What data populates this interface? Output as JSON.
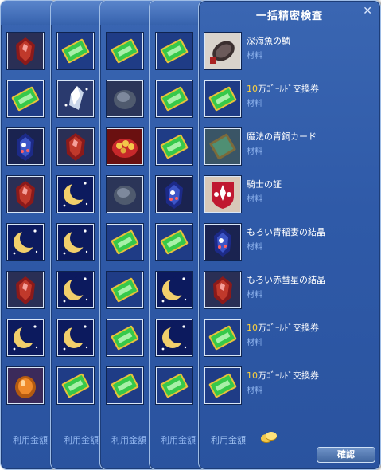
{
  "background_panels": [
    {
      "fee_label": "利用金額",
      "slots": [
        "red-gem-icon",
        "gold-ticket-icon",
        "blue-gem-icon",
        "red-gem-icon",
        "moon-icon",
        "red-gem-icon",
        "moon-icon",
        "orange-gem-icon"
      ]
    },
    {
      "fee_label": "利用金額",
      "slots": [
        "gold-ticket-icon",
        "crystal-icon",
        "red-gem-icon",
        "moon-icon",
        "moon-icon",
        "moon-icon",
        "moon-icon",
        "gold-ticket-icon"
      ]
    },
    {
      "fee_label": "利用金額",
      "slots": [
        "gold-ticket-icon",
        "stone-icon",
        "treasure-icon",
        "stone-icon",
        "gold-ticket-icon",
        "gold-ticket-icon",
        "gold-ticket-icon",
        "gold-ticket-icon"
      ]
    },
    {
      "fee_label": "利用金額",
      "slots": [
        "gold-ticket-icon",
        "gold-ticket-icon",
        "gold-ticket-icon",
        "blue-gem-icon",
        "gold-ticket-icon",
        "moon-icon",
        "moon-icon",
        "gold-ticket-icon"
      ]
    }
  ],
  "dialog": {
    "title": "一括精密検査",
    "close_icon": "close-icon",
    "items": [
      {
        "icon": "scale-icon",
        "name_highlight": "",
        "name": "深海魚の鱗",
        "category": "材料"
      },
      {
        "icon": "gold-ticket-icon",
        "name_highlight": "10",
        "name": "万ｺﾞｰﾙﾄﾞ交換券",
        "category": "材料"
      },
      {
        "icon": "card-icon",
        "name_highlight": "",
        "name": "魔法の青銅カード",
        "category": "材料"
      },
      {
        "icon": "emblem-icon",
        "name_highlight": "",
        "name": "騎士の証",
        "category": "材料"
      },
      {
        "icon": "blue-gem-icon",
        "name_highlight": "",
        "name": "もろい青稲妻の結晶",
        "category": "材料"
      },
      {
        "icon": "red-gem-icon",
        "name_highlight": "",
        "name": "もろい赤彗星の結晶",
        "category": "材料"
      },
      {
        "icon": "gold-ticket-icon",
        "name_highlight": "10",
        "name": "万ｺﾞｰﾙﾄﾞ交換券",
        "category": "材料"
      },
      {
        "icon": "gold-ticket-icon",
        "name_highlight": "10",
        "name": "万ｺﾞｰﾙﾄﾞ交換券",
        "category": "材料"
      }
    ],
    "fee_label": "利用金額",
    "coin_icon": "coin-icon",
    "confirm_label": "確認"
  },
  "colors": {
    "panel_blue": "#2f5aa8",
    "label_blue": "#8fb4ee",
    "highlight_yellow": "#ffd23a",
    "ticket_green": "#36c94a"
  }
}
